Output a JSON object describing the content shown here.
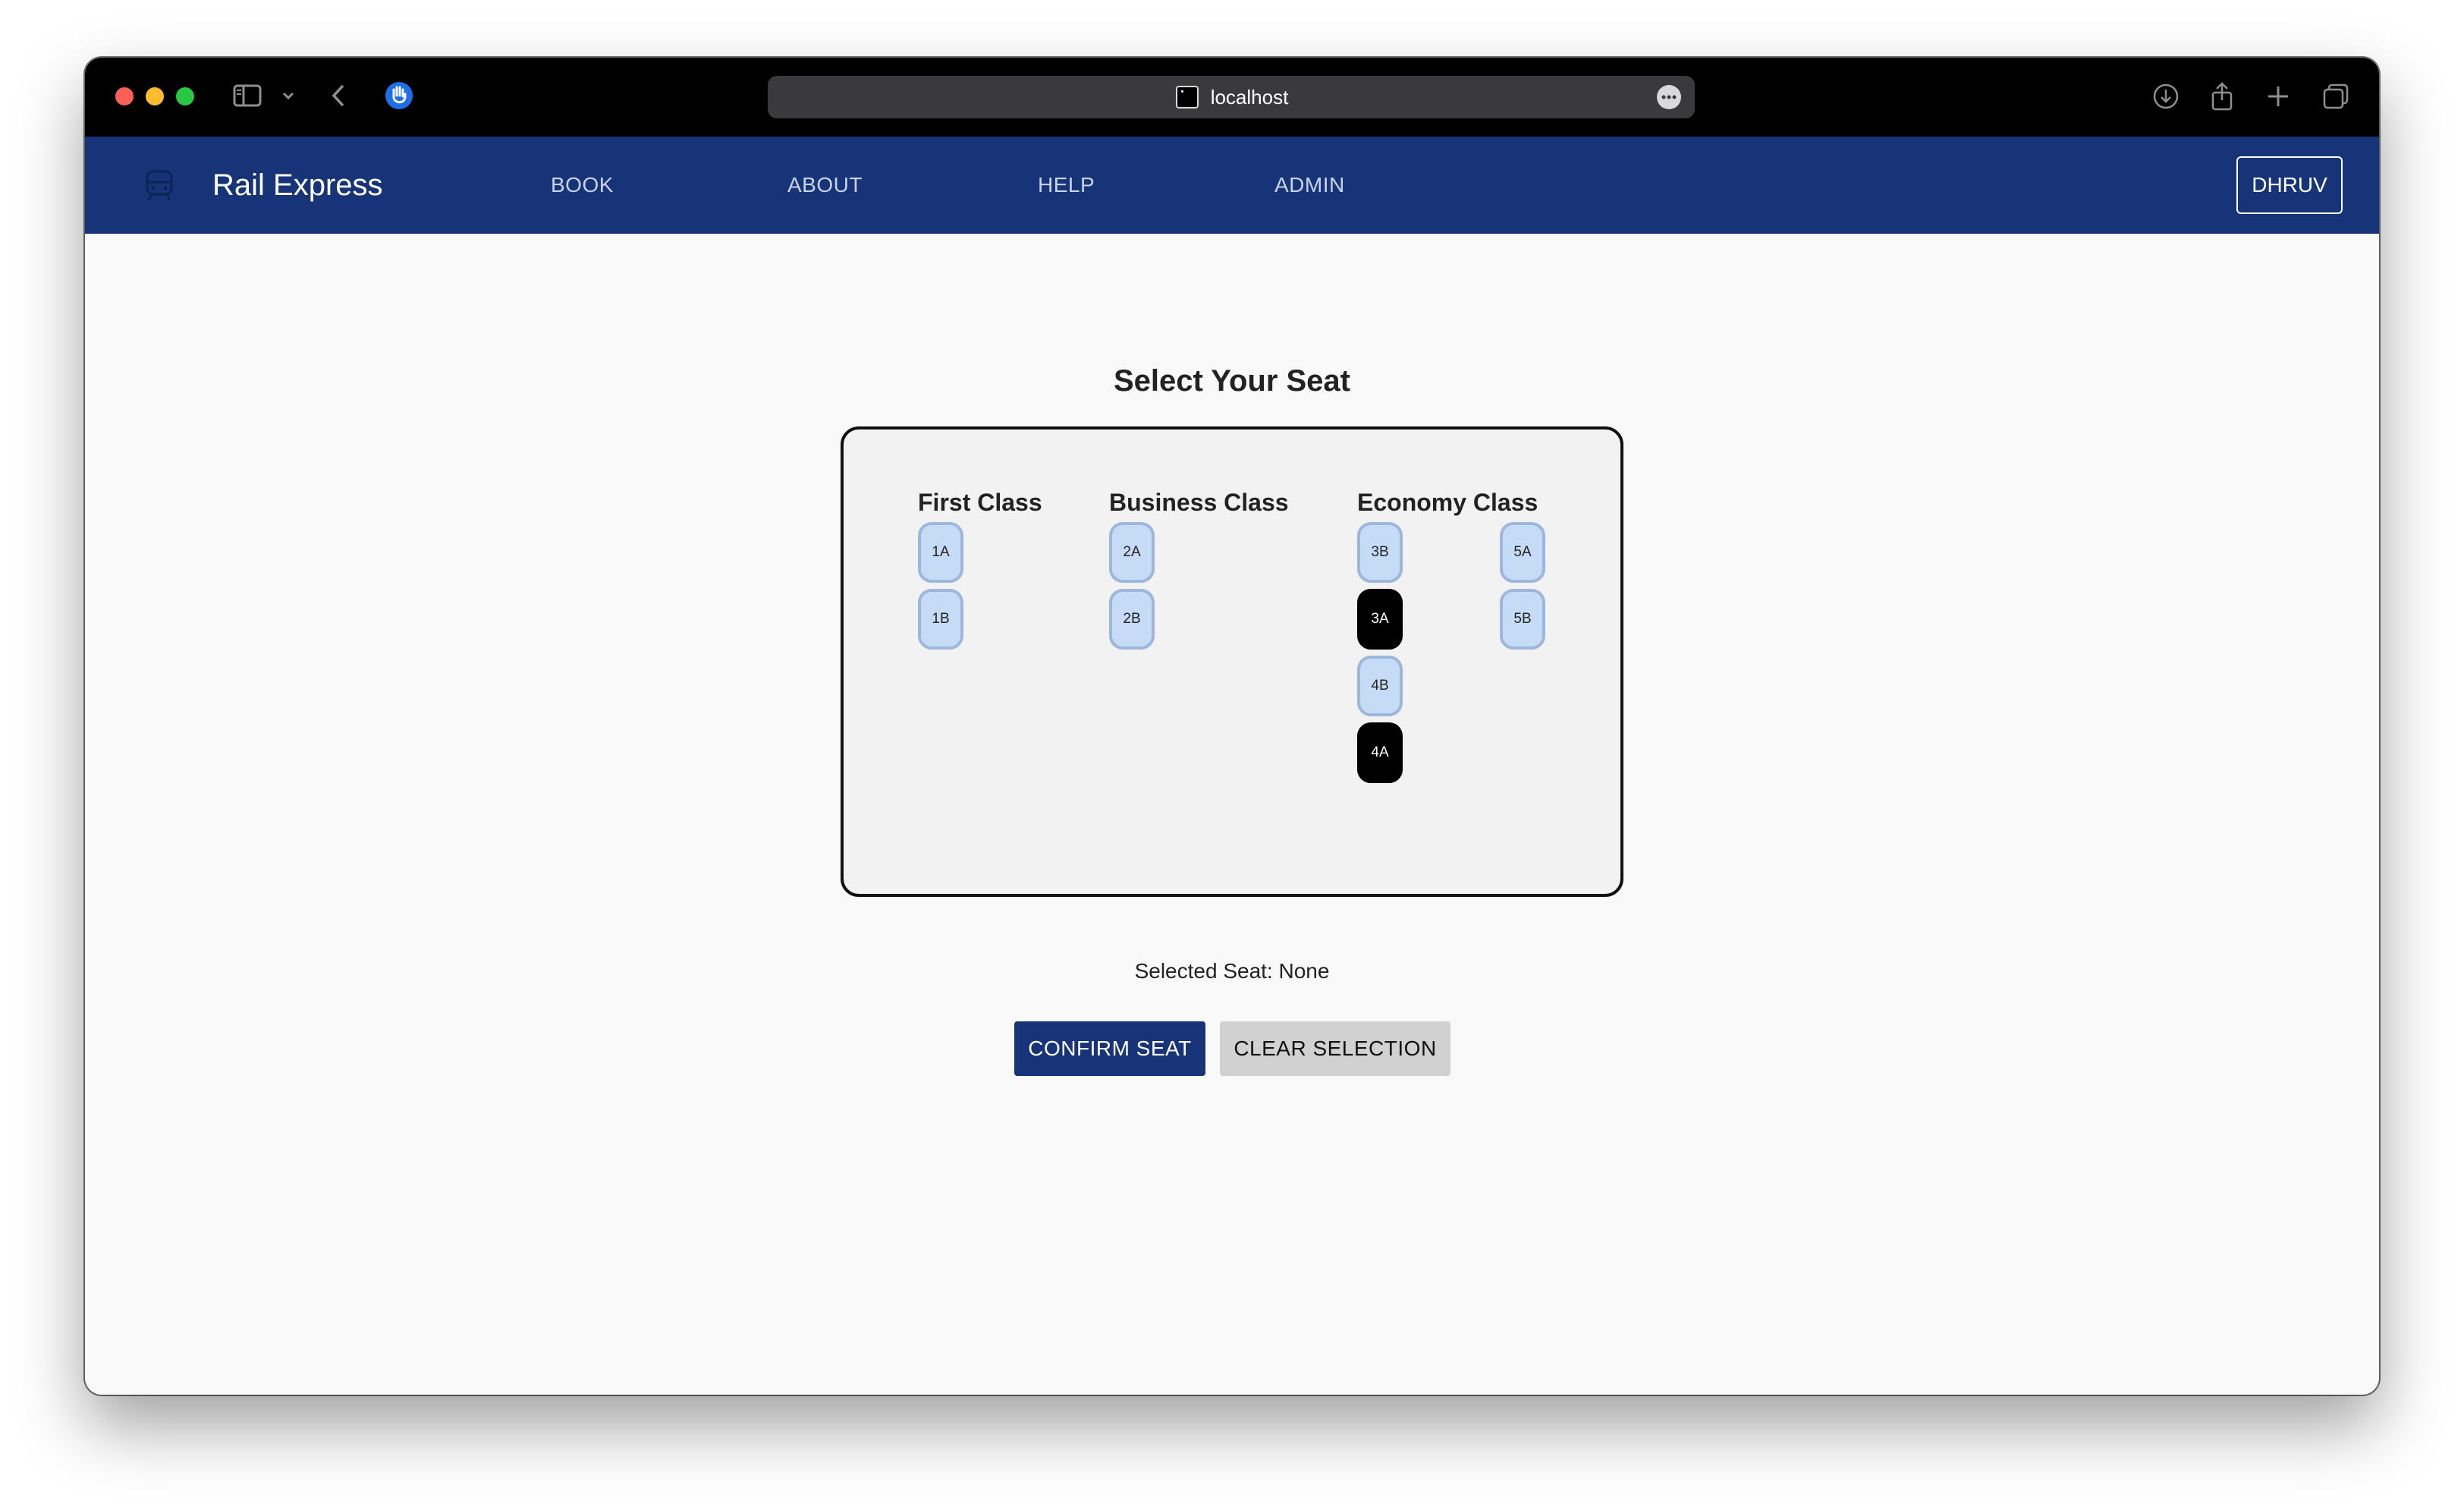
{
  "browser": {
    "url": "localhost"
  },
  "app": {
    "brand": "Rail Express",
    "nav": [
      "BOOK",
      "ABOUT",
      "HELP",
      "ADMIN"
    ],
    "user": "DHRUV"
  },
  "page": {
    "title": "Select Your Seat",
    "classes": {
      "first": "First Class",
      "business": "Business Class",
      "economy": "Economy Class"
    },
    "seats": [
      {
        "id": "1A",
        "class": "First Class",
        "status": "available"
      },
      {
        "id": "1B",
        "class": "First Class",
        "status": "available"
      },
      {
        "id": "2A",
        "class": "Business Class",
        "status": "available"
      },
      {
        "id": "2B",
        "class": "Business Class",
        "status": "available"
      },
      {
        "id": "3B",
        "class": "Economy Class",
        "status": "available"
      },
      {
        "id": "3A",
        "class": "Economy Class",
        "status": "booked"
      },
      {
        "id": "4B",
        "class": "Economy Class",
        "status": "available"
      },
      {
        "id": "4A",
        "class": "Economy Class",
        "status": "booked"
      },
      {
        "id": "5A",
        "class": "Economy Class",
        "status": "available"
      },
      {
        "id": "5B",
        "class": "Economy Class",
        "status": "available"
      }
    ],
    "selected_seat": "Selected Seat: None",
    "confirm_label": "CONFIRM SEAT",
    "clear_label": "CLEAR SELECTION"
  },
  "colors": {
    "nav_bg": "#163477",
    "seat_available": "#c6dbf5",
    "seat_booked": "#000000",
    "clear_button": "#d1d1d1"
  }
}
